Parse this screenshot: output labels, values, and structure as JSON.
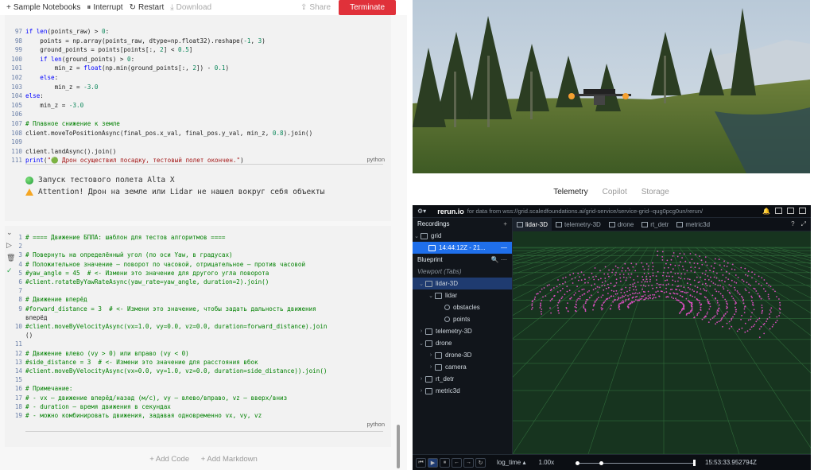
{
  "toolbar": {
    "sample": "Sample Notebooks",
    "interrupt": "Interrupt",
    "restart": "Restart",
    "download": "Download",
    "share": "Share",
    "terminate": "Terminate"
  },
  "cell1": {
    "lines": [
      {
        "n": "97",
        "t": "if len(points_raw) > 0:"
      },
      {
        "n": "98",
        "t": "    points = np.array(points_raw, dtype=np.float32).reshape(-1, 3)"
      },
      {
        "n": "99",
        "t": "    ground_points = points[points[:, 2] < 0.5]"
      },
      {
        "n": "100",
        "t": "    if len(ground_points) > 0:"
      },
      {
        "n": "101",
        "t": "        min_z = float(np.min(ground_points[:, 2]) - 0.1)"
      },
      {
        "n": "102",
        "t": "    else:"
      },
      {
        "n": "103",
        "t": "        min_z = -3.0"
      },
      {
        "n": "104",
        "t": "else:"
      },
      {
        "n": "105",
        "t": "    min_z = -3.0"
      },
      {
        "n": "106",
        "t": ""
      },
      {
        "n": "107",
        "t": "# Плавное снижение к земле"
      },
      {
        "n": "108",
        "t": "client.moveToPositionAsync(final_pos.x_val, final_pos.y_val, min_z, 0.8).join()"
      },
      {
        "n": "109",
        "t": ""
      },
      {
        "n": "110",
        "t": "client.landAsync().join()"
      },
      {
        "n": "111",
        "t": "print(\"🟢 Дрон осуществил посадку, тестовый полет окончен.\")"
      }
    ],
    "lang": "python",
    "out1": "Запуск тестового полета Alta X",
    "out2": "Attention! Дрон на земле или Lidar не нашел вокруг себя объекты"
  },
  "cell2": {
    "lines": [
      {
        "n": "1",
        "t": "# ==== Движение БПЛА: шаблон для тестов алгоритмов ===="
      },
      {
        "n": "2",
        "t": ""
      },
      {
        "n": "3",
        "t": "# Повернуть на определённый угол (по оси Yaw, в градусах)"
      },
      {
        "n": "4",
        "t": "# Положительное значение — поворот по часовой, отрицательное — против часовой"
      },
      {
        "n": "5",
        "t": "#yaw_angle = 45  # <- Измени это значение для другого угла поворота"
      },
      {
        "n": "6",
        "t": "#client.rotateByYawRateAsync(yaw_rate=yaw_angle, duration=2).join()"
      },
      {
        "n": "7",
        "t": ""
      },
      {
        "n": "8",
        "t": "# Движение вперёд"
      },
      {
        "n": "9",
        "t": "#forward_distance = 3  # <- Измени это значение, чтобы задать дальность движения"
      },
      {
        "n": "",
        "t": "вперёд"
      },
      {
        "n": "10",
        "t": "#client.moveByVelocityAsync(vx=1.0, vy=0.0, vz=0.0, duration=forward_distance).join"
      },
      {
        "n": "",
        "t": "()"
      },
      {
        "n": "11",
        "t": ""
      },
      {
        "n": "12",
        "t": "# Движение влево (vy > 0) или вправо (vy < 0)"
      },
      {
        "n": "13",
        "t": "#side_distance = 3  # <- Измени это значение для расстояния вбок"
      },
      {
        "n": "14",
        "t": "#client.moveByVelocityAsync(vx=0.0, vy=1.0, vz=0.0, duration=side_distance)).join()"
      },
      {
        "n": "15",
        "t": ""
      },
      {
        "n": "16",
        "t": "# Примечание:"
      },
      {
        "n": "17",
        "t": "# - vx — движение вперёд/назад (м/с), vy — влево/вправо, vz — вверх/вниз"
      },
      {
        "n": "18",
        "t": "# - duration — время движения в секундах"
      },
      {
        "n": "19",
        "t": "# - можно комбинировать движения, задавая одновременно vx, vy, vz"
      }
    ],
    "lang": "python"
  },
  "addbar": {
    "code": "+ Add Code",
    "markdown": "+ Add Markdown"
  },
  "right_tabs": {
    "telemetry": "Telemetry",
    "copilot": "Copilot",
    "storage": "Storage"
  },
  "rerun": {
    "logo": "rerun.io",
    "source": "for data from wss://grid.scaledfoundations.ai/grid-service/service-grid--qug0pcg0un/rerun/",
    "recordings": "Recordings",
    "rec_grid": "grid",
    "rec_time": "14:44:12Z - 21...",
    "blueprint": "Blueprint",
    "viewport": "Viewport (Tabs)",
    "tree": [
      {
        "label": "lidar-3D",
        "indent": 0,
        "type": "view"
      },
      {
        "label": "lidar",
        "indent": 1,
        "type": "entity"
      },
      {
        "label": "obstacles",
        "indent": 2,
        "type": "dot"
      },
      {
        "label": "points",
        "indent": 2,
        "type": "dot"
      },
      {
        "label": "telemetry-3D",
        "indent": 0,
        "type": "view"
      },
      {
        "label": "drone",
        "indent": 0,
        "type": "view"
      },
      {
        "label": "drone-3D",
        "indent": 1,
        "type": "view"
      },
      {
        "label": "camera",
        "indent": 1,
        "type": "view"
      },
      {
        "label": "rt_detr",
        "indent": 0,
        "type": "view"
      },
      {
        "label": "metric3d",
        "indent": 0,
        "type": "view"
      }
    ],
    "tabs": [
      "lidar-3D",
      "telemetry-3D",
      "drone",
      "rt_detr",
      "metric3d"
    ],
    "timeline": "log_time",
    "speed": "1.00x",
    "time": "15:53:33.952794Z"
  }
}
